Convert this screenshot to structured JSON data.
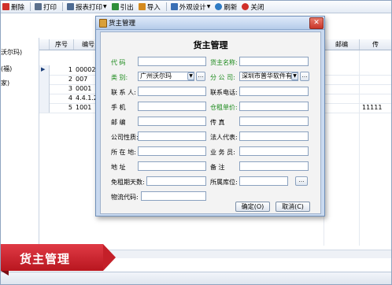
{
  "toolbar": {
    "items": [
      {
        "label": "删除",
        "icon": "delete-icon",
        "color": "#d0302a"
      },
      {
        "label": "打印",
        "icon": "printer-icon",
        "color": "#5a6f8c"
      },
      {
        "label": "报表打印",
        "icon": "report-print-icon",
        "color": "#4d6a91"
      },
      {
        "label": "引出",
        "icon": "export-icon",
        "color": "#2f8f3a"
      },
      {
        "label": "导入",
        "icon": "import-icon",
        "color": "#d48a1e"
      },
      {
        "label": "外观设计",
        "icon": "design-icon",
        "color": "#3a6fb5"
      },
      {
        "label": "刷新",
        "icon": "refresh-icon",
        "color": "#2e7bc4"
      },
      {
        "label": "关闭",
        "icon": "close-icon",
        "color": "#d0302a"
      }
    ]
  },
  "left_panel": {
    "items": [
      "沃尔玛)",
      "(福)",
      "家)"
    ]
  },
  "grid": {
    "headers": [
      "序号",
      "编号",
      "邮编",
      "传"
    ],
    "rows": [
      {
        "seq": "1",
        "code": "00002",
        "extra": ""
      },
      {
        "seq": "2",
        "code": "007",
        "extra": ""
      },
      {
        "seq": "3",
        "code": "0001",
        "extra": ""
      },
      {
        "seq": "4",
        "code": "4.4.1.2",
        "extra": ""
      },
      {
        "seq": "5",
        "code": "1001",
        "extra": "11111"
      }
    ],
    "row_indicator": "▶"
  },
  "dialog": {
    "title": "货主管理",
    "heading": "货主管理",
    "close_glyph": "✕",
    "fields": {
      "code": {
        "label": "代 码",
        "value": ""
      },
      "owner_name": {
        "label": "货主名称:",
        "value": ""
      },
      "category": {
        "label": "类 别:",
        "value": "广州沃尔玛"
      },
      "branch": {
        "label": "分 公 司:",
        "value": "深圳市普华软件有限"
      },
      "contact": {
        "label": "联 系 人:",
        "value": ""
      },
      "phone": {
        "label": "联系电话:",
        "value": ""
      },
      "mobile": {
        "label": "手 机",
        "value": ""
      },
      "rent_unit": {
        "label": "仓租单价:",
        "value": ""
      },
      "postcode": {
        "label": "邮 编",
        "value": ""
      },
      "fax": {
        "label": "传 真",
        "value": ""
      },
      "company_type": {
        "label": "公司性质:",
        "value": ""
      },
      "legal_rep": {
        "label": "法人代表:",
        "value": ""
      },
      "location": {
        "label": "所 在 地:",
        "value": ""
      },
      "salesman": {
        "label": "业 务 员:",
        "value": ""
      },
      "address": {
        "label": "地 址",
        "value": ""
      },
      "remark": {
        "label": "备 注",
        "value": ""
      },
      "free_days": {
        "label": "免租期天数:",
        "value": ""
      },
      "warehouse": {
        "label": "所属库位:",
        "value": ""
      },
      "logistics_code": {
        "label": "物流代码:",
        "value": ""
      }
    },
    "ok_label": "确定(O)",
    "cancel_label": "取消(C)"
  },
  "banner": {
    "text": "货主管理",
    "color": "#c42029"
  }
}
